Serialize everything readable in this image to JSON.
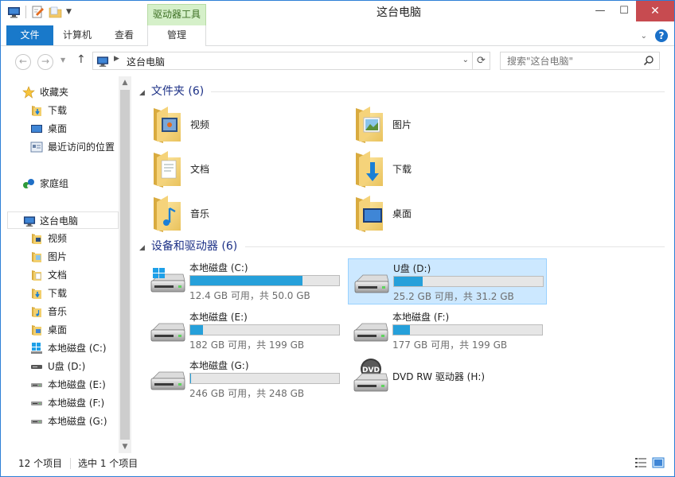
{
  "window": {
    "title": "这台电脑",
    "context_tab_title": "驱动器工具",
    "close_glyph": "✕",
    "maximize_glyph": "☐",
    "minimize_glyph": "—"
  },
  "ribbon": {
    "tabs": [
      {
        "label": "文件"
      },
      {
        "label": "计算机"
      },
      {
        "label": "查看"
      },
      {
        "label": "管理"
      }
    ],
    "help": "?"
  },
  "address": {
    "path": "这台电脑",
    "search_placeholder": "搜索\"这台电脑\""
  },
  "sidebar": {
    "favorites": {
      "label": "收藏夹",
      "items": [
        {
          "label": "下载",
          "icon": "downloads-folder-icon"
        },
        {
          "label": "桌面",
          "icon": "desktop-icon"
        },
        {
          "label": "最近访问的位置",
          "icon": "recent-places-icon"
        }
      ]
    },
    "homegroup": {
      "label": "家庭组"
    },
    "this_pc": {
      "label": "这台电脑",
      "items": [
        {
          "label": "视频"
        },
        {
          "label": "图片"
        },
        {
          "label": "文档"
        },
        {
          "label": "下载"
        },
        {
          "label": "音乐"
        },
        {
          "label": "桌面"
        },
        {
          "label": "本地磁盘 (C:)"
        },
        {
          "label": "U盘 (D:)"
        },
        {
          "label": "本地磁盘 (E:)"
        },
        {
          "label": "本地磁盘 (F:)"
        },
        {
          "label": "本地磁盘 (G:)"
        }
      ]
    }
  },
  "main": {
    "folders_header": "文件夹 (6)",
    "folders": [
      {
        "label": "视频",
        "icon": "videos-folder-icon"
      },
      {
        "label": "图片",
        "icon": "pictures-folder-icon"
      },
      {
        "label": "文档",
        "icon": "documents-folder-icon"
      },
      {
        "label": "下载",
        "icon": "downloads-folder-icon"
      },
      {
        "label": "音乐",
        "icon": "music-folder-icon"
      },
      {
        "label": "桌面",
        "icon": "desktop-folder-icon"
      }
    ],
    "drives_header": "设备和驱动器 (6)",
    "drives": [
      {
        "name": "本地磁盘 (C:)",
        "size_text": "12.4 GB 可用，共 50.0 GB",
        "used_fraction": 0.752
      },
      {
        "name": "U盘 (D:)",
        "size_text": "25.2 GB 可用，共 31.2 GB",
        "used_fraction": 0.192
      },
      {
        "name": "本地磁盘 (E:)",
        "size_text": "182 GB 可用，共 199 GB",
        "used_fraction": 0.085
      },
      {
        "name": "本地磁盘 (F:)",
        "size_text": "177 GB 可用，共 199 GB",
        "used_fraction": 0.11
      },
      {
        "name": "本地磁盘 (G:)",
        "size_text": "246 GB 可用，共 248 GB",
        "used_fraction": 0.008
      },
      {
        "name": "DVD RW 驱动器 (H:)",
        "dvd_label": "DVD"
      }
    ]
  },
  "status": {
    "item_count": "12 个项目",
    "selection": "选中 1 个项目"
  },
  "colors": {
    "accent": "#1979ca",
    "context_tab": "#d5f0c9",
    "selection": "#cce8ff",
    "bar_fill": "#26a0da",
    "header_text": "#1e3287"
  }
}
